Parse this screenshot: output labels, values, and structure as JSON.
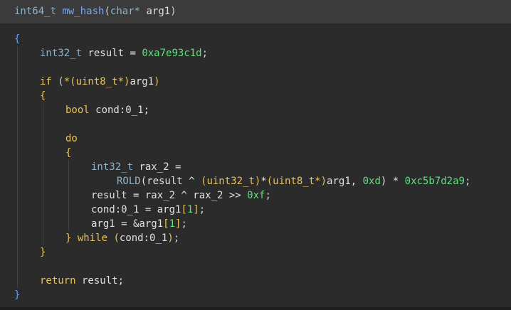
{
  "signature": {
    "return_type": "int64_t",
    "function_name": "mw_hash",
    "open_paren": "(",
    "param_type": "char*",
    "param_name": "arg1",
    "close_paren": ")"
  },
  "code_lines": [
    {
      "indent": 0,
      "tokens": [
        {
          "t": "{",
          "c": "brace-outer"
        }
      ]
    },
    {
      "indent": 1,
      "tokens": [
        {
          "t": "int32_t",
          "c": "type"
        },
        {
          "t": " result = ",
          "c": "plain"
        },
        {
          "t": "0xa7e93c1d",
          "c": "num"
        },
        {
          "t": ";",
          "c": "punc"
        }
      ]
    },
    {
      "indent": 0,
      "tokens": []
    },
    {
      "indent": 1,
      "tokens": [
        {
          "t": "if",
          "c": "keyword"
        },
        {
          "t": " (",
          "c": "punc"
        },
        {
          "t": "*(",
          "c": "keyword"
        },
        {
          "t": "uint8_t*",
          "c": "keyword"
        },
        {
          "t": ")",
          "c": "keyword"
        },
        {
          "t": "arg1",
          "c": "plain"
        },
        {
          "t": ")",
          "c": "keyword"
        }
      ]
    },
    {
      "indent": 1,
      "tokens": [
        {
          "t": "{",
          "c": "brace"
        }
      ]
    },
    {
      "indent": 2,
      "tokens": [
        {
          "t": "bool",
          "c": "keyword"
        },
        {
          "t": " cond:0_1;",
          "c": "plain"
        }
      ]
    },
    {
      "indent": 0,
      "tokens": []
    },
    {
      "indent": 2,
      "tokens": [
        {
          "t": "do",
          "c": "keyword"
        }
      ]
    },
    {
      "indent": 2,
      "tokens": [
        {
          "t": "{",
          "c": "brace"
        }
      ]
    },
    {
      "indent": 3,
      "tokens": [
        {
          "t": "int32_t",
          "c": "type"
        },
        {
          "t": " rax_2 =",
          "c": "plain"
        }
      ]
    },
    {
      "indent": 4,
      "tokens": [
        {
          "t": "ROLD",
          "c": "type"
        },
        {
          "t": "(result ^ ",
          "c": "plain"
        },
        {
          "t": "(uint32_t)",
          "c": "keyword"
        },
        {
          "t": "*",
          "c": "plain"
        },
        {
          "t": "(uint8_t*)",
          "c": "keyword"
        },
        {
          "t": "arg1, ",
          "c": "plain"
        },
        {
          "t": "0xd",
          "c": "num"
        },
        {
          "t": ") * ",
          "c": "plain"
        },
        {
          "t": "0xc5b7d2a9",
          "c": "num"
        },
        {
          "t": ";",
          "c": "punc"
        }
      ]
    },
    {
      "indent": 3,
      "tokens": [
        {
          "t": "result = rax_2 ^ rax_2 >> ",
          "c": "plain"
        },
        {
          "t": "0xf",
          "c": "num"
        },
        {
          "t": ";",
          "c": "punc"
        }
      ]
    },
    {
      "indent": 3,
      "tokens": [
        {
          "t": "cond:0_1 = arg1",
          "c": "plain"
        },
        {
          "t": "[",
          "c": "keyword"
        },
        {
          "t": "1",
          "c": "num"
        },
        {
          "t": "]",
          "c": "keyword"
        },
        {
          "t": ";",
          "c": "punc"
        }
      ]
    },
    {
      "indent": 3,
      "tokens": [
        {
          "t": "arg1 = &arg1",
          "c": "plain"
        },
        {
          "t": "[",
          "c": "keyword"
        },
        {
          "t": "1",
          "c": "num"
        },
        {
          "t": "]",
          "c": "keyword"
        },
        {
          "t": ";",
          "c": "punc"
        }
      ]
    },
    {
      "indent": 2,
      "tokens": [
        {
          "t": "}",
          "c": "brace"
        },
        {
          "t": " while ",
          "c": "keyword"
        },
        {
          "t": "(",
          "c": "keyword"
        },
        {
          "t": "cond:0_1",
          "c": "plain"
        },
        {
          "t": ")",
          "c": "keyword"
        },
        {
          "t": ";",
          "c": "punc"
        }
      ]
    },
    {
      "indent": 1,
      "tokens": [
        {
          "t": "}",
          "c": "brace"
        }
      ]
    },
    {
      "indent": 0,
      "tokens": []
    },
    {
      "indent": 1,
      "tokens": [
        {
          "t": "return",
          "c": "keyword"
        },
        {
          "t": " result;",
          "c": "plain"
        }
      ]
    },
    {
      "indent": 0,
      "tokens": [
        {
          "t": "}",
          "c": "brace-outer"
        }
      ]
    }
  ]
}
